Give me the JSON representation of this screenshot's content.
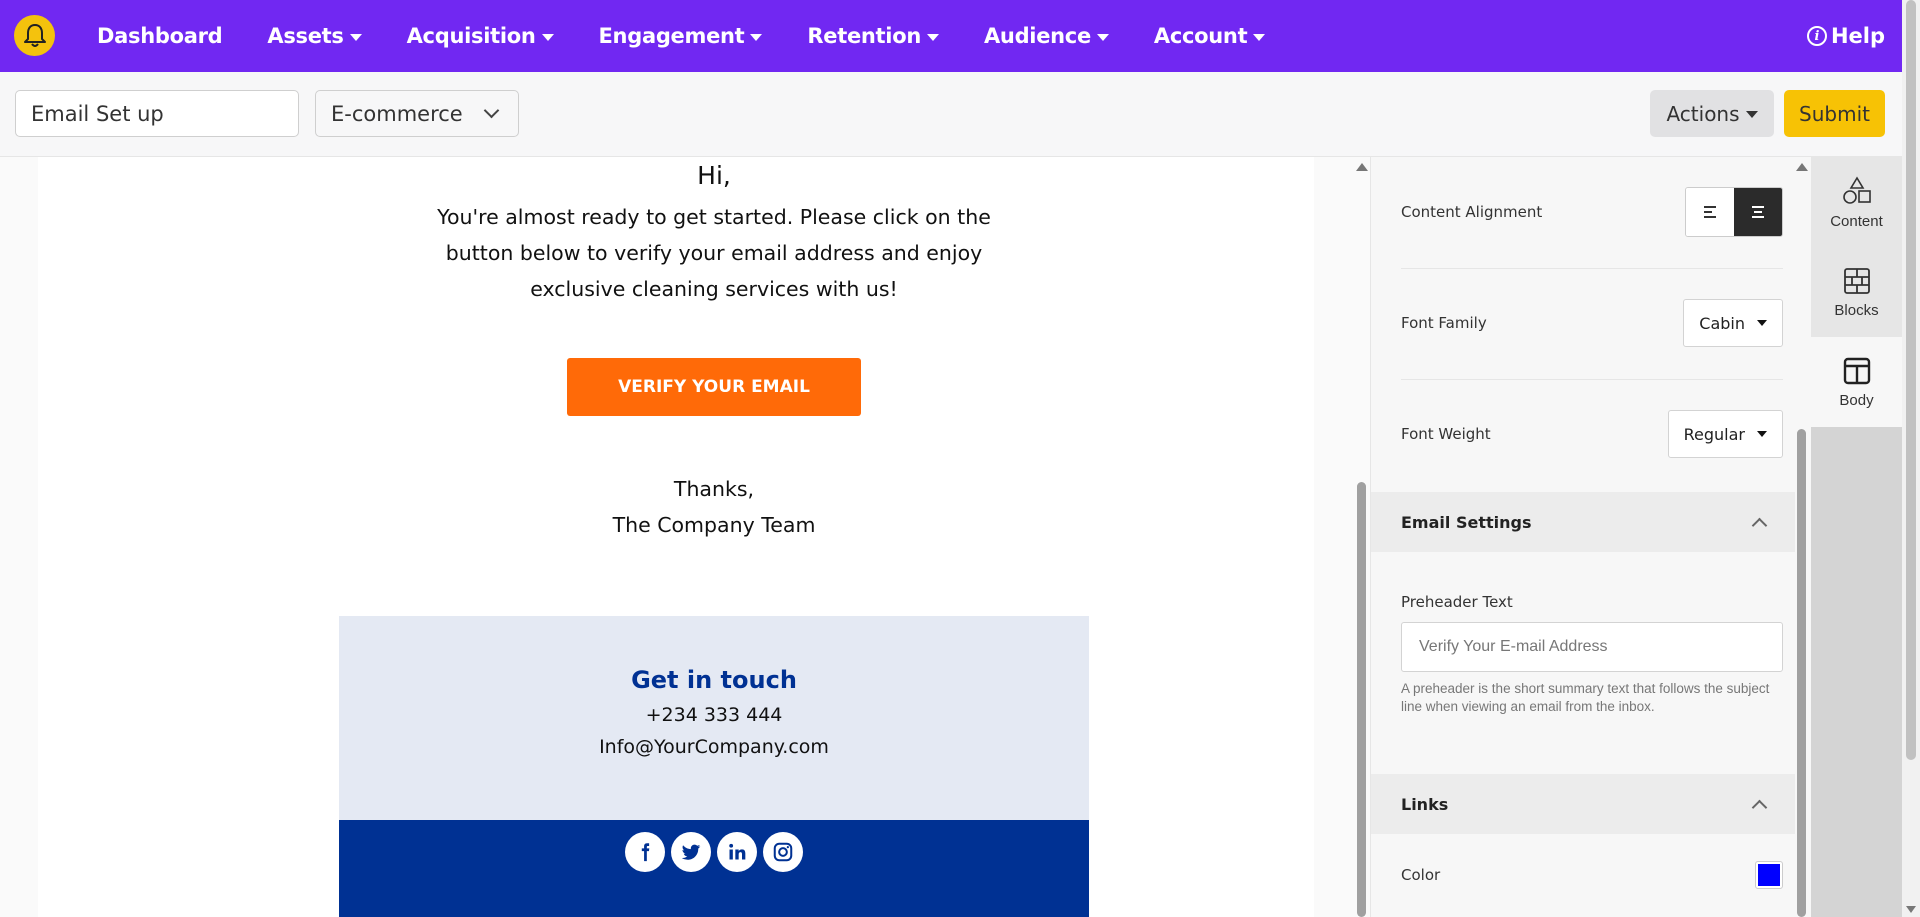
{
  "nav": {
    "items": [
      {
        "label": "Dashboard",
        "dropdown": false
      },
      {
        "label": "Assets",
        "dropdown": true
      },
      {
        "label": "Acquisition",
        "dropdown": true
      },
      {
        "label": "Engagement",
        "dropdown": true
      },
      {
        "label": "Retention",
        "dropdown": true
      },
      {
        "label": "Audience",
        "dropdown": true
      },
      {
        "label": "Account",
        "dropdown": true
      }
    ],
    "help_label": "Help",
    "bell_icon": "bell-icon",
    "colors": {
      "bar": "#7128f2",
      "bell": "#f4c20d"
    }
  },
  "toolbar": {
    "name_value": "Email Set up",
    "category_value": "E-commerce",
    "actions_label": "Actions",
    "submit_label": "Submit"
  },
  "email": {
    "greeting": "Hi,",
    "message": "You're almost ready to get started. Please click on the button below to verify your email address and enjoy exclusive cleaning services with us!",
    "button_label": "VERIFY YOUR EMAIL",
    "signoff_line1": "Thanks,",
    "signoff_line2": "The Company Team",
    "contact_title": "Get in touch",
    "contact_phone": "+234 333 444",
    "contact_email": "Info@YourCompany.com",
    "social_icons": [
      "facebook-icon",
      "twitter-icon",
      "linkedin-icon",
      "instagram-icon"
    ],
    "colors": {
      "button": "#ff6a08",
      "contact_bg": "#e4e9f3",
      "footer_bg": "#003193"
    }
  },
  "panel": {
    "content_alignment_label": "Content Alignment",
    "alignment_selected": "center",
    "font_family_label": "Font Family",
    "font_family_value": "Cabin",
    "font_weight_label": "Font Weight",
    "font_weight_value": "Regular",
    "email_settings_header": "Email Settings",
    "preheader_label": "Preheader Text",
    "preheader_placeholder": "Verify Your E-mail Address",
    "preheader_hint": "A preheader is the short summary text that follows the subject line when viewing an email from the inbox.",
    "links_header": "Links",
    "color_label": "Color",
    "link_color": "#0000ff"
  },
  "sidetabs": [
    {
      "label": "Content",
      "icon": "shapes-icon"
    },
    {
      "label": "Blocks",
      "icon": "blocks-icon"
    },
    {
      "label": "Body",
      "icon": "layout-icon",
      "active": true
    }
  ]
}
